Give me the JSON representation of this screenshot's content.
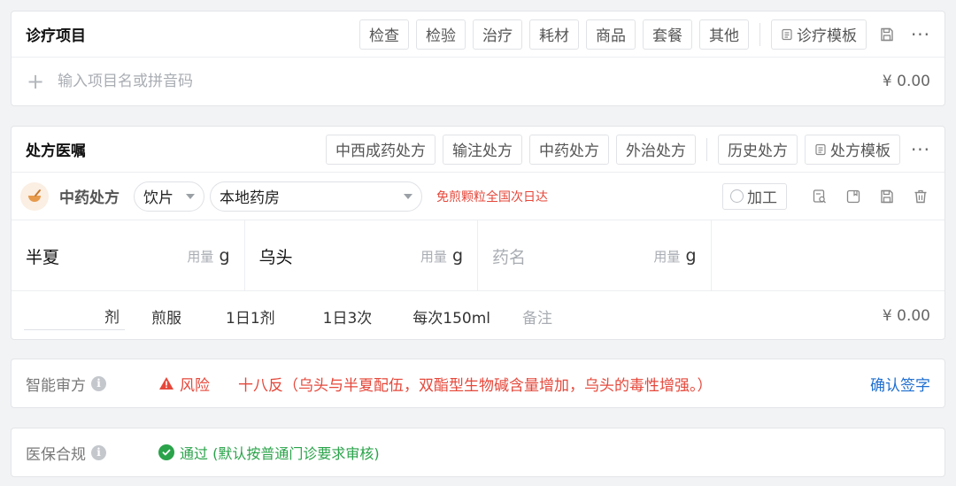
{
  "diagnosis": {
    "title": "诊疗项目",
    "categories": [
      "检查",
      "检验",
      "治疗",
      "耗材",
      "商品",
      "套餐",
      "其他"
    ],
    "template_label": "诊疗模板",
    "add_placeholder": "输入项目名或拼音码",
    "total": "¥ 0.00"
  },
  "prescription": {
    "title": "处方医嘱",
    "types": [
      "中西成药处方",
      "输注处方",
      "中药处方",
      "外治处方"
    ],
    "history_label": "历史处方",
    "template_label": "处方模板",
    "rx_type": "中药处方",
    "form_select": "饮片",
    "pharmacy_select": "本地药房",
    "notice": "免煎颗粒全国次日达",
    "process_label": "加工",
    "herbs": [
      {
        "name": "半夏",
        "dosage_label": "用量",
        "unit": "g"
      },
      {
        "name": "乌头",
        "dosage_label": "用量",
        "unit": "g"
      },
      {
        "name": "药名",
        "dosage_label": "用量",
        "unit": "g"
      }
    ],
    "usage": {
      "dose_unit": "剂",
      "method": "煎服",
      "frequency_day": "1日1剂",
      "frequency_times": "1日3次",
      "amount": "每次150ml",
      "note_placeholder": "备注",
      "total": "¥ 0.00"
    }
  },
  "audit": {
    "label": "智能审方",
    "status": "风险",
    "message": "十八反（乌头与半夏配伍，双酯型生物碱含量增加，乌头的毒性增强。）",
    "action": "确认签字"
  },
  "insurance": {
    "label": "医保合规",
    "status": "通过 (默认按普通门诊要求审核)"
  },
  "colors": {
    "risk": "#e5483b",
    "pass": "#2aa34a",
    "link": "#1f6fd0"
  }
}
